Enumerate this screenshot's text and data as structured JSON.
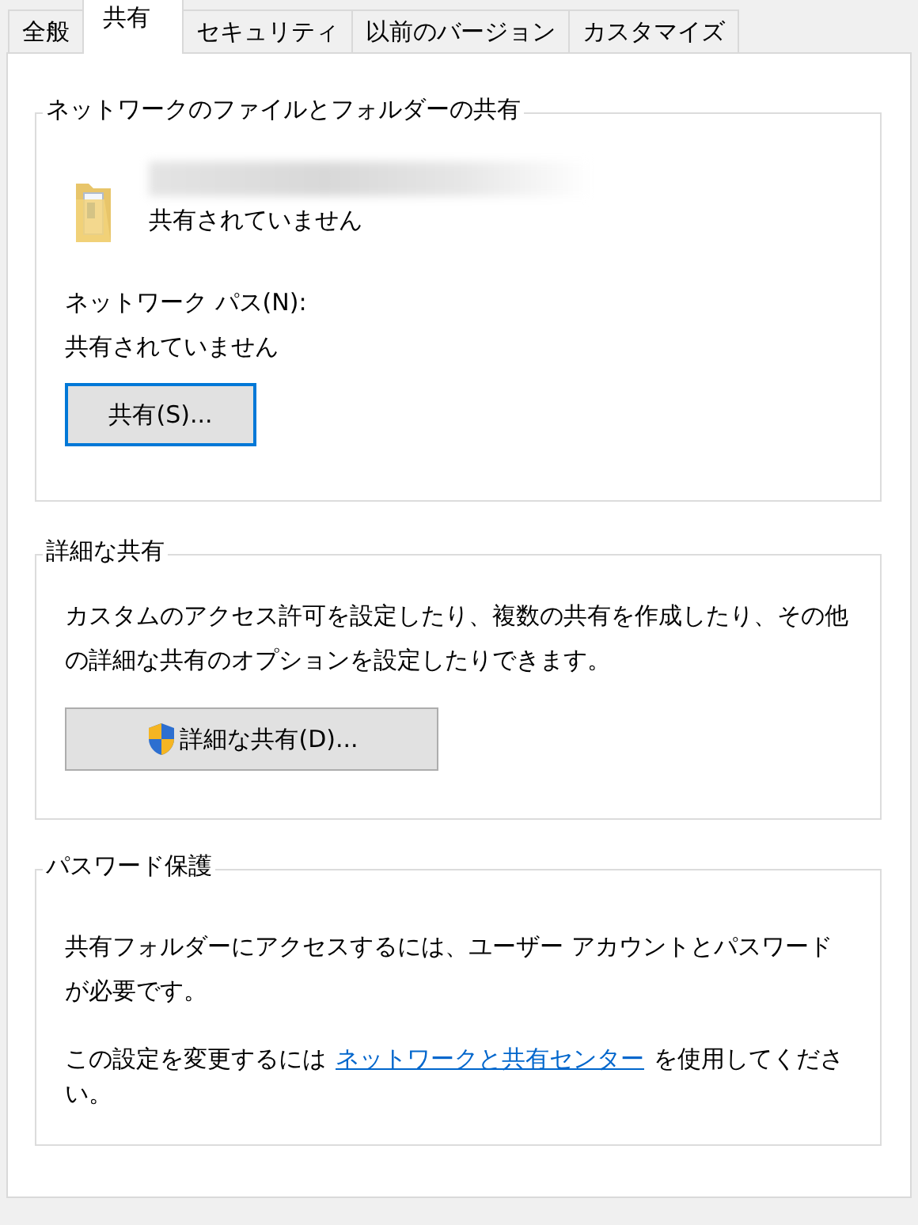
{
  "tabs": [
    {
      "label": "全般",
      "selected": false
    },
    {
      "label": "共有",
      "selected": true
    },
    {
      "label": "セキュリティ",
      "selected": false
    },
    {
      "label": "以前のバージョン",
      "selected": false
    },
    {
      "label": "カスタマイズ",
      "selected": false
    }
  ],
  "network_sharing": {
    "title": "ネットワークのファイルとフォルダーの共有",
    "folder_status": "共有されていません",
    "path_label": "ネットワーク パス(N):",
    "path_value": "共有されていません",
    "button": {
      "label": "共有(S)...",
      "focused": true
    }
  },
  "advanced_sharing": {
    "title": "詳細な共有",
    "description": "カスタムのアクセス許可を設定したり、複数の共有を作成したり、その他の詳細な共有のオプションを設定したりできます。",
    "button": {
      "label": "詳細な共有(D)...",
      "focused": false
    }
  },
  "password_protection": {
    "title": "パスワード保護",
    "description": "共有フォルダーにアクセスするには、ユーザー アカウントとパスワードが必要です。",
    "change_prefix": "この設定を変更するには",
    "link": "ネットワークと共有センター",
    "change_suffix": "を使用してください。"
  }
}
